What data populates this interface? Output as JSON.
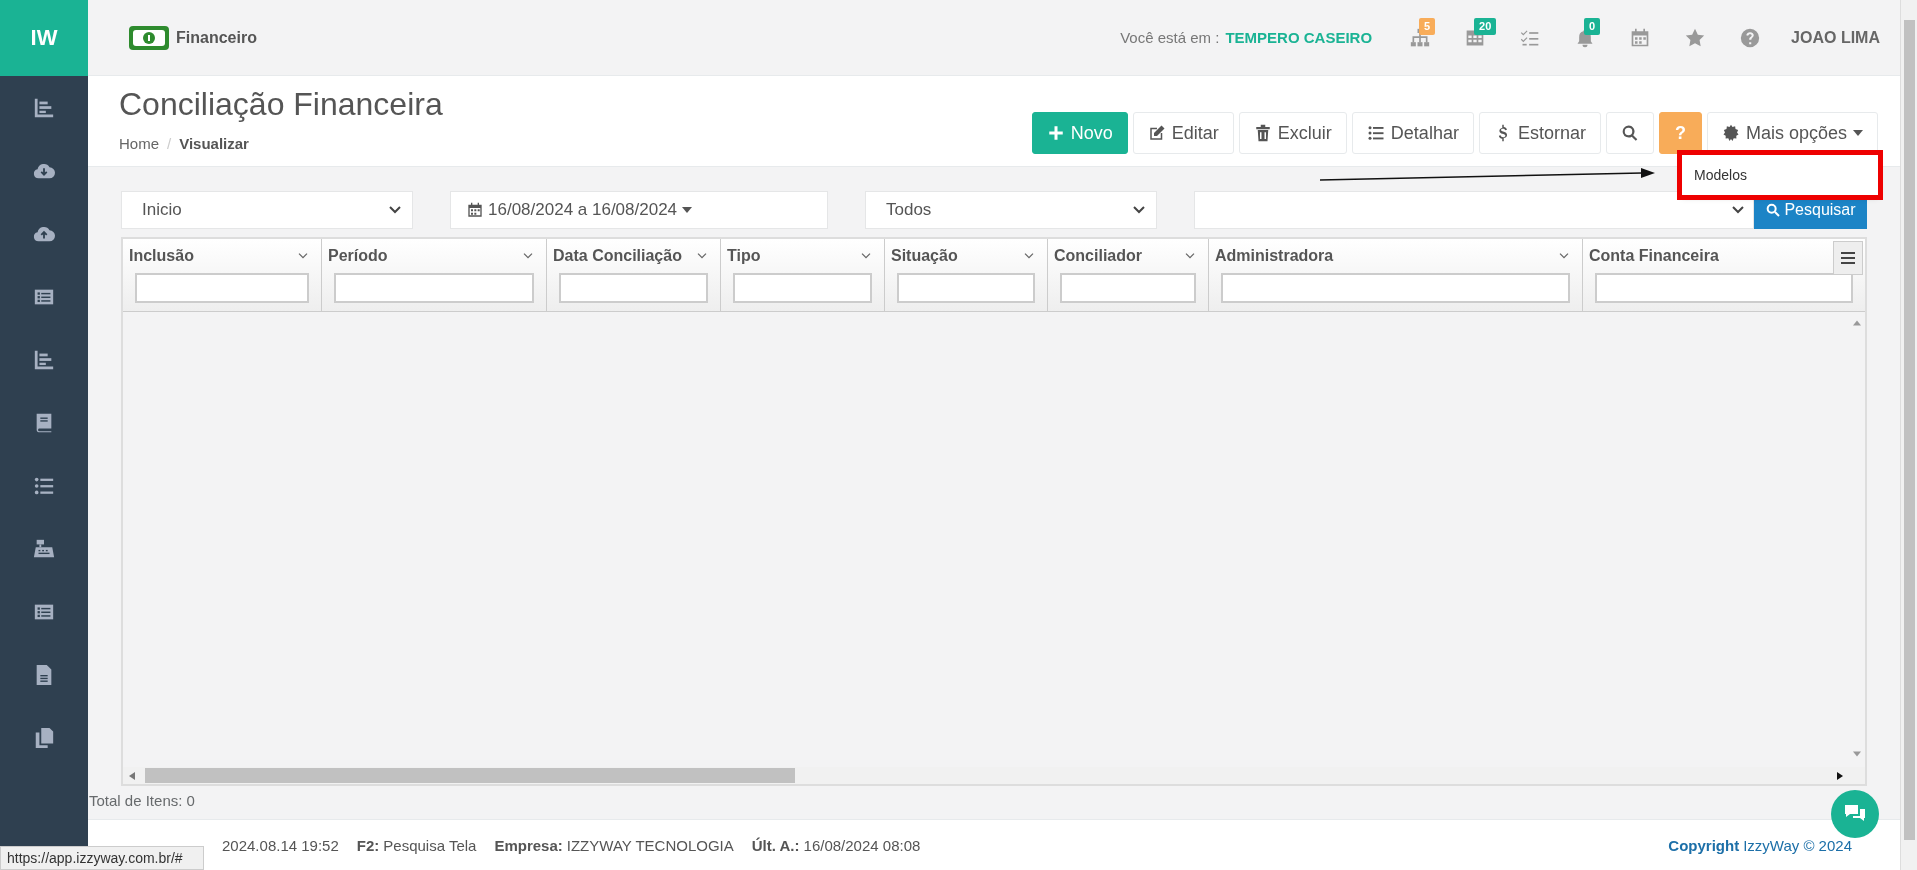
{
  "sidebar": {
    "logo": "IW",
    "items": [
      {
        "kind": "chart"
      },
      {
        "kind": "cloud-down"
      },
      {
        "kind": "cloud-up"
      },
      {
        "kind": "list-box"
      },
      {
        "kind": "chart"
      },
      {
        "kind": "book"
      },
      {
        "kind": "list"
      },
      {
        "kind": "register"
      },
      {
        "kind": "list-box"
      },
      {
        "kind": "file"
      },
      {
        "kind": "copy"
      }
    ]
  },
  "topbar": {
    "module": "Financeiro",
    "location_label": "Você está em :",
    "location": "TEMPERO CASEIRO",
    "user": "JOAO LIMA",
    "icons": [
      {
        "kind": "sitemap",
        "badge": "5",
        "color": "#f8ac59"
      },
      {
        "kind": "grid",
        "badge": "20",
        "color": "#1ab394"
      },
      {
        "kind": "tasks"
      },
      {
        "kind": "bell",
        "badge": "0",
        "color": "#1ab394"
      },
      {
        "kind": "calendar"
      },
      {
        "kind": "star"
      },
      {
        "kind": "help"
      }
    ]
  },
  "page": {
    "title": "Conciliação Financeira",
    "breadcrumb_separator": "/",
    "breadcrumb": [
      {
        "label": "Home",
        "selected": false
      },
      {
        "label": "Visualizar",
        "selected": true
      }
    ]
  },
  "toolbar": [
    {
      "kind": "plus",
      "label": "Novo"
    },
    {
      "kind": "edit",
      "label": "Editar"
    },
    {
      "kind": "trash",
      "label": "Excluir"
    },
    {
      "kind": "list",
      "label": "Detalhar"
    },
    {
      "kind": "dollar",
      "label": "Estornar"
    },
    {
      "kind": "search"
    },
    {
      "kind": "text",
      "label": "?"
    },
    {
      "kind": "gear",
      "label": "Mais opções",
      "caret": true
    }
  ],
  "menu": {
    "items": [
      "Modelos"
    ],
    "highlighted": true
  },
  "filters": {
    "date_type": "Inicio",
    "period": "16/08/2024 a 16/08/2024",
    "status": "Todos",
    "search_button": "Pesquisar"
  },
  "table": {
    "columns": [
      "Inclusão",
      "Período",
      "Data Conciliação",
      "Tipo",
      "Situação",
      "Conciliador",
      "Administradora",
      "Conta Financeira"
    ],
    "total": "Total de Itens: 0"
  },
  "footer": {
    "version": "2024.08.14 19:52",
    "fields": [
      {
        "label": "F2:",
        "value": "Pesquisa Tela"
      },
      {
        "label": "Empresa:",
        "value": "IZZYWAY TECNOLOGIA"
      },
      {
        "label": "Últ. A.:",
        "value": "16/08/2024 08:08"
      }
    ],
    "copyright_label": "Copyright",
    "copyright": "IzzyWay © 2024"
  },
  "status_url": "https://app.izzyway.com.br/#"
}
